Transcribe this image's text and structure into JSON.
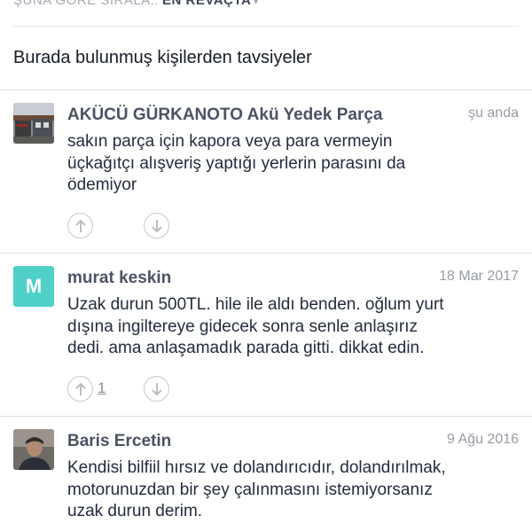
{
  "sort": {
    "label": "ŞUNA GÖRE SIRALA::",
    "value": "EN REVAÇTA",
    "caret": "▾"
  },
  "section_title": "Burada bulunmuş kişilerden tavsiyeler",
  "tips": [
    {
      "author": "AKÜCÜ GÜRKANOTO Akü Yedek Parça",
      "date": "şu anda",
      "lines": [
        "sakın parça için kapora veya para vermeyin",
        "üçkağıtçı alışveriş yaptığı yerlerin parasını da",
        "ödemiyor"
      ],
      "upvotes": ""
    },
    {
      "author": "murat keskin",
      "avatar_letter": "M",
      "date": "18 Mar 2017",
      "lines": [
        "Uzak durun 500TL. hile ile aldı benden. oğlum yurt",
        "dışına ingiltereye gidecek  sonra senle anlaşırız",
        "dedi. ama anlaşamadık parada gitti. dikkat edin."
      ],
      "upvotes": "1"
    },
    {
      "author": "Baris Ercetin",
      "date": "9 Ağu 2016",
      "lines": [
        "Kendisi bilfiil hırsız ve dolandırıcıdır, dolandırılmak,",
        "motorunuzdan bir şey çalınmasını istemiyorsanız",
        "uzak durun derim."
      ]
    }
  ],
  "colors": {
    "accent_teal": "#4fd1c9",
    "text_dark": "#242c3d",
    "muted": "#979ca7"
  },
  "icons": {
    "upvote": "arrow-up-icon",
    "downvote": "arrow-down-icon"
  }
}
